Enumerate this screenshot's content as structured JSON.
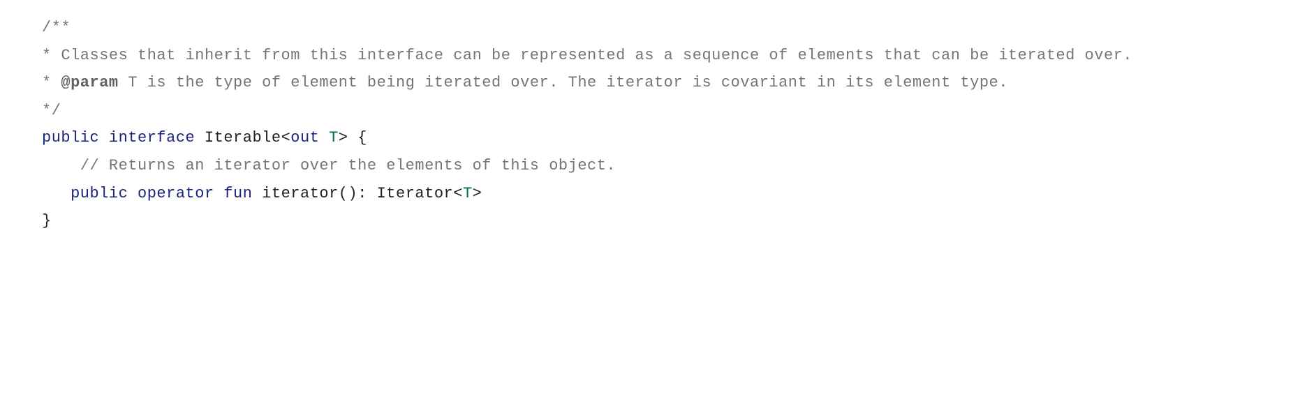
{
  "code": {
    "doc_open": "/**",
    "doc_line1_prefix": "* ",
    "doc_line1_text": "Classes that inherit from this interface can be represented as a sequence of elements that can be iterated over.",
    "doc_line2_prefix": "* ",
    "doc_line2_tag": "@param",
    "doc_line2_text": " T is the type of element being iterated over. The iterator is covariant in its element type.",
    "doc_close": "*/",
    "decl": {
      "public": "public",
      "interface": "interface",
      "name": "Iterable",
      "lt": "<",
      "out": "out",
      "tparam": "T",
      "gt": ">",
      "brace_open": " {"
    },
    "inner_comment": "    // Returns an iterator over the elements of this object.",
    "method": {
      "indent": "   ",
      "public": "public",
      "operator": "operator",
      "fun": "fun",
      "name": "iterator",
      "parens": "()",
      "colon": ": ",
      "ret_type": "Iterator",
      "lt": "<",
      "tparam": "T",
      "gt": ">"
    },
    "brace_close": "}"
  }
}
